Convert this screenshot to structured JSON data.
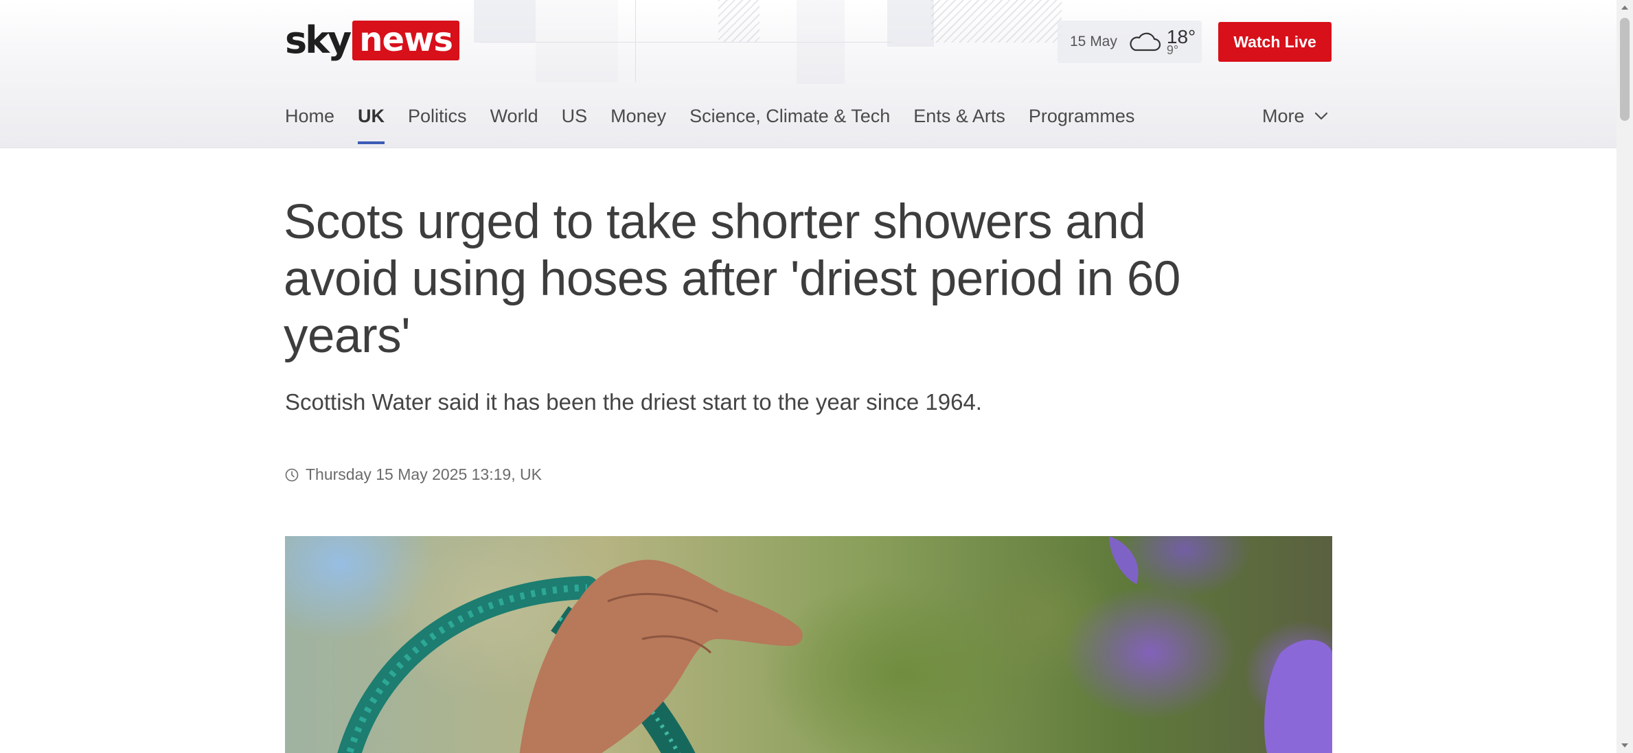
{
  "brand": {
    "logo_sky": "sky",
    "logo_news": "news",
    "accent_red": "#d7101a",
    "nav_indicator": "#3b5bb5"
  },
  "weather": {
    "date": "15 May",
    "icon": "cloud-icon",
    "high": "18°",
    "low": "9°"
  },
  "header": {
    "watch_live_label": "Watch Live"
  },
  "nav": {
    "items": [
      {
        "label": "Home",
        "active": false
      },
      {
        "label": "UK",
        "active": true
      },
      {
        "label": "Politics",
        "active": false
      },
      {
        "label": "World",
        "active": false
      },
      {
        "label": "US",
        "active": false
      },
      {
        "label": "Money",
        "active": false
      },
      {
        "label": "Science, Climate & Tech",
        "active": false
      },
      {
        "label": "Ents & Arts",
        "active": false
      },
      {
        "label": "Programmes",
        "active": false
      }
    ],
    "more_label": "More"
  },
  "article": {
    "headline": "Scots urged to take shorter showers and avoid using hoses after 'driest period in 60 years'",
    "standfirst": "Scottish Water said it has been the driest start to the year since 1964.",
    "timestamp": "Thursday 15 May 2025 13:19, UK"
  }
}
